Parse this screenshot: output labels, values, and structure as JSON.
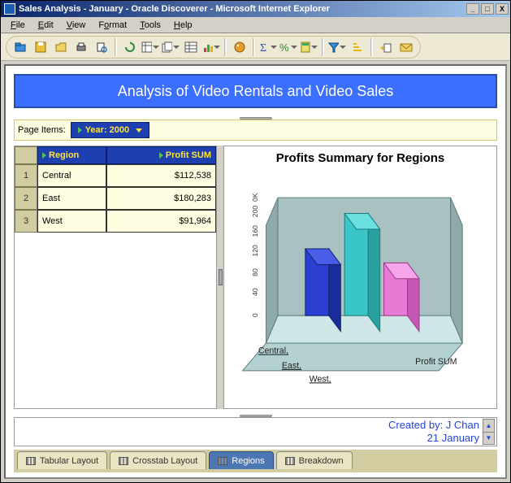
{
  "window": {
    "title": "Sales Analysis - January - Oracle Discoverer - Microsoft Internet Explorer"
  },
  "menu": {
    "items": [
      "File",
      "Edit",
      "View",
      "Format",
      "Tools",
      "Help"
    ]
  },
  "banner": "Analysis of Video Rentals and Video Sales",
  "pageitems": {
    "label": "Page Items:",
    "year_label": "Year:  2000"
  },
  "table": {
    "columns": [
      "Region",
      "Profit SUM"
    ],
    "rows": [
      {
        "n": "1",
        "region": "Central",
        "profit": "$112,538"
      },
      {
        "n": "2",
        "region": "East",
        "profit": "$180,283"
      },
      {
        "n": "3",
        "region": "West",
        "profit": "$91,964"
      }
    ]
  },
  "chart": {
    "title": "Profits Summary for Regions",
    "axis_label": "Profit SUM",
    "categories": [
      "Central,",
      "East,",
      "West,"
    ],
    "ticks": [
      "0",
      "40",
      "80",
      "120",
      "160",
      "200",
      "0K"
    ]
  },
  "chart_data": {
    "type": "bar",
    "title": "Profits Summary for Regions",
    "categories": [
      "Central",
      "East",
      "West"
    ],
    "series": [
      {
        "name": "Profit SUM",
        "values": [
          112538,
          180283,
          91964
        ]
      }
    ],
    "ylabel": "Profit SUM",
    "ylim": [
      0,
      200000
    ],
    "yticks": [
      0,
      40000,
      80000,
      120000,
      160000,
      200000
    ]
  },
  "footer": {
    "created_by": "Created by: J Chan",
    "date": "21 January"
  },
  "tabs": [
    "Tabular Layout",
    "Crosstab Layout",
    "Regions",
    "Breakdown"
  ],
  "active_tab": 2
}
